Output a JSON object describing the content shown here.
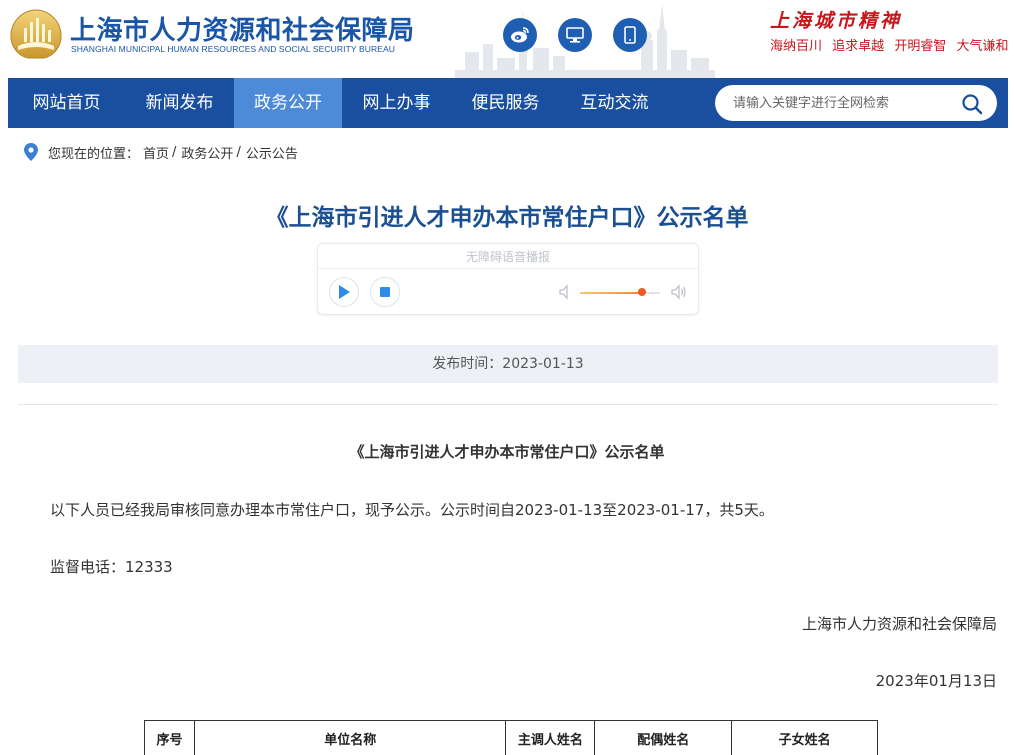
{
  "header": {
    "site_name": "上海市人力资源和社会保障局",
    "site_name_en": "SHANGHAI MUNICIPAL HUMAN RESOURCES AND SOCIAL SECURITY BUREAU",
    "social": [
      {
        "name": "weibo-icon"
      },
      {
        "name": "computer-icon"
      },
      {
        "name": "mobile-icon"
      }
    ],
    "city_spirit_title": "上海城市精神",
    "city_spirit_words": [
      "海纳百川",
      "追求卓越",
      "开明睿智",
      "大气谦和"
    ]
  },
  "nav": {
    "items": [
      {
        "label": "网站首页",
        "active": false
      },
      {
        "label": "新闻发布",
        "active": false
      },
      {
        "label": "政务公开",
        "active": true
      },
      {
        "label": "网上办事",
        "active": false
      },
      {
        "label": "便民服务",
        "active": false
      },
      {
        "label": "互动交流",
        "active": false
      }
    ],
    "search_placeholder": "请输入关键字进行全网检索"
  },
  "breadcrumb": {
    "prefix": "您现在的位置：",
    "items": [
      "首页",
      "政务公开",
      "公示公告"
    ]
  },
  "article": {
    "title": "《上海市引进人才申办本市常住户口》公示名单",
    "player": {
      "label": "无障碍语音播报",
      "volume": 0.78
    },
    "publish_time": "发布时间：2023-01-13",
    "body_heading": "《上海市引进人才申办本市常住户口》公示名单",
    "intro": "以下人员已经我局审核同意办理本市常住户口，现予公示。公示时间自2023-01-13至2023-01-17，共5天。",
    "hotline": "监督电话：12333",
    "signature": "上海市人力资源和社会保障局",
    "date": "2023年01月13日",
    "table_headers": [
      "序号",
      "单位名称",
      "主调人姓名",
      "配偶姓名",
      "子女姓名"
    ]
  },
  "colors": {
    "nav_bg": "#1a4fa0",
    "nav_active": "#4d8ad8",
    "title": "#1a4f91",
    "spirit_red": "#c8161d"
  }
}
